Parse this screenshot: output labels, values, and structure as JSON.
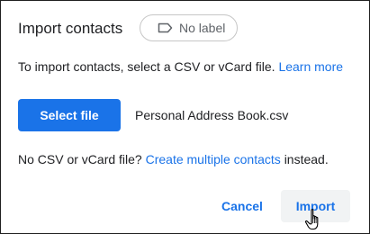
{
  "dialog": {
    "title": "Import contacts",
    "label_chip": {
      "icon": "label-outline-icon",
      "text": "No label"
    },
    "description": {
      "text": "To import contacts, select a CSV or vCard file.",
      "link": "Learn more"
    },
    "select_file_button": "Select file",
    "selected_file_name": "Personal Address Book.csv",
    "note": {
      "prefix": "No CSV or vCard file?",
      "link": "Create multiple contacts",
      "suffix": "instead."
    },
    "actions": {
      "cancel": "Cancel",
      "import": "Import"
    },
    "pointer": "hand-pointer-cursor-icon"
  },
  "colors": {
    "accent": "#1a73e8",
    "text": "#202124",
    "muted": "#5f6368",
    "chip_border": "#c6c6c6",
    "import_hover_bg": "#f1f3f4"
  }
}
